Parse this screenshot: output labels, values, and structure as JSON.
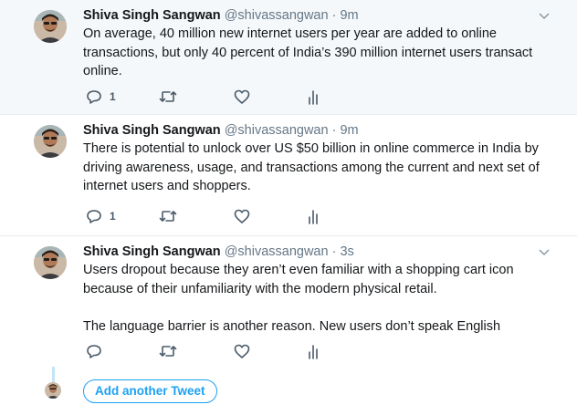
{
  "tweets": [
    {
      "author_name": "Shiva Singh Sangwan",
      "handle": "@shivassangwan",
      "separator": " · ",
      "time": "9m",
      "paragraphs": [
        "On average, 40 million new internet users per year are added to online transactions, but only 40 percent of India’s 390 million internet users transact online."
      ],
      "reply_count": "1"
    },
    {
      "author_name": "Shiva Singh Sangwan",
      "handle": "@shivassangwan",
      "separator": " · ",
      "time": "9m",
      "paragraphs": [
        "There is potential to unlock over US $50 billion in online commerce in India by driving awareness, usage, and transactions among the current and next set of internet users and shoppers."
      ],
      "reply_count": "1"
    },
    {
      "author_name": "Shiva Singh Sangwan",
      "handle": "@shivassangwan",
      "separator": " · ",
      "time": "3s",
      "paragraphs": [
        "Users dropout because they aren’t even familiar with a shopping cart icon because of their unfamiliarity with the modern physical retail.",
        "The language barrier is another reason. New users don’t speak English"
      ],
      "reply_count": ""
    }
  ],
  "compose": {
    "add_button_label": "Add another Tweet"
  },
  "icons": {
    "reply": "reply-icon",
    "retweet": "retweet-icon",
    "like": "like-heart-icon",
    "analytics": "analytics-icon",
    "caret": "chevron-down-icon"
  },
  "colors": {
    "accent": "#1da1f2",
    "thread_line": "#c4e4f7",
    "highlight_bg": "#f5f8fa",
    "secondary_text": "#657786"
  }
}
